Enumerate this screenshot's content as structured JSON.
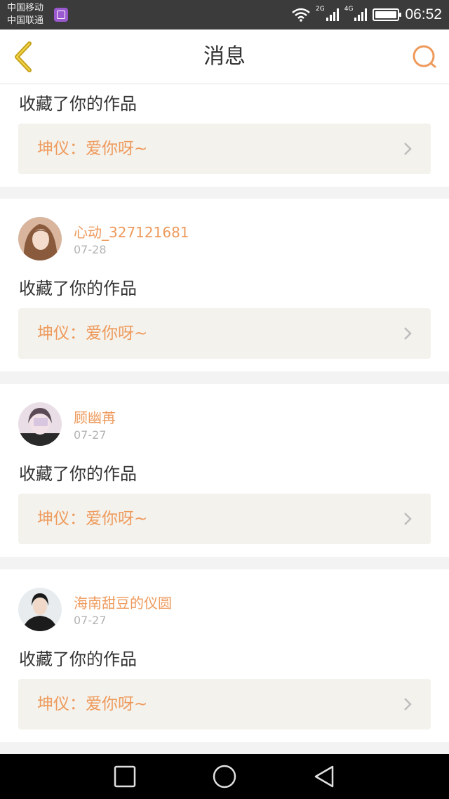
{
  "status_bar": {
    "carrier_1": "中国移动",
    "carrier_2": "中国联通",
    "net_1": "2G",
    "net_2": "4G",
    "time": "06:52"
  },
  "header": {
    "title": "消息",
    "back_icon": "chevron-left-icon",
    "search_icon": "search-icon"
  },
  "colors": {
    "accent": "#ee9a5c",
    "back_arrow": "#c6a11a",
    "quote_bg": "#f4f2ec",
    "page_bg": "#f3f3f3"
  },
  "messages": [
    {
      "action": "收藏了你的作品",
      "quote": "坤仪：爱你呀~"
    },
    {
      "username": "心动_327121681",
      "date": "07-28",
      "action": "收藏了你的作品",
      "quote": "坤仪：爱你呀~"
    },
    {
      "username": "顾幽苒",
      "date": "07-27",
      "action": "收藏了你的作品",
      "quote": "坤仪：爱你呀~"
    },
    {
      "username": "海南甜豆的仪圆",
      "date": "07-27",
      "action": "收藏了你的作品",
      "quote": "坤仪：爱你呀~"
    }
  ],
  "nav_bar": {
    "recents_icon": "square-icon",
    "home_icon": "circle-icon",
    "back_icon": "triangle-back-icon"
  }
}
